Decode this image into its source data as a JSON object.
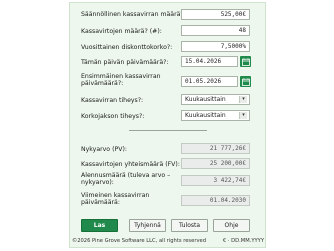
{
  "form": {
    "periodic_payment": {
      "label": "Säännöllinen kassavirran määrä?:",
      "value": "525,00€"
    },
    "payment_count": {
      "label": "Kassavirtojen määrä? (#):",
      "value": "48"
    },
    "discount_rate": {
      "label": "Vuosittainen diskonttokorko?:",
      "value": "7,5000%"
    },
    "current_date": {
      "label": "Tämän päivän päivämäärä?:",
      "value": "15.04.2026"
    },
    "first_date": {
      "label": "Ensimmäinen kassavirran päivämäärä?:",
      "value": "01.05.2026"
    },
    "frequency": {
      "label": "Kassavirran tiheys?:",
      "value": "Kuukausittain"
    },
    "compounding": {
      "label": "Korkojakson tiheys?:",
      "value": "Kuukausittain"
    }
  },
  "results": {
    "present_value": {
      "label": "Nykyarvo (PV):",
      "value": "21 777,26€"
    },
    "future_value": {
      "label": "Kassavirtojen yhteismäärä (FV):",
      "value": "25 200,00€"
    },
    "discount_amount": {
      "label": "Alennusmäärä (tuleva arvo – nykyarvo):",
      "value": "3 422,74€"
    },
    "last_date": {
      "label": "Viimeinen kassavirran päivämäärä:",
      "value": "01.04.2030"
    }
  },
  "buttons": {
    "calculate": "Las",
    "clear": "Tyhjennä",
    "print": "Tulosta",
    "help": "Ohje"
  },
  "footer": {
    "copyright": "©2026 Pine Grove Software LLC, all rights reserved",
    "format": "€ · DD.MM.YYYY"
  }
}
